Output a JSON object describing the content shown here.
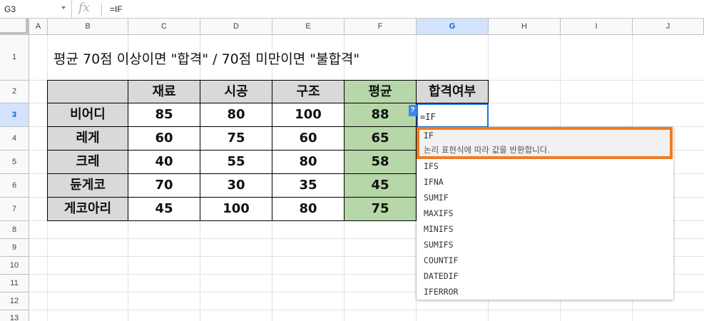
{
  "formula_bar": {
    "cell_ref": "G3",
    "fx_label": "fx",
    "formula": "=IF"
  },
  "columns": [
    "A",
    "B",
    "C",
    "D",
    "E",
    "F",
    "G",
    "H",
    "I",
    "J"
  ],
  "rows": [
    "1",
    "2",
    "3",
    "4",
    "5",
    "6",
    "7",
    "8",
    "9",
    "10",
    "11",
    "12",
    "13"
  ],
  "title": "평균 70점 이상이면 \"합격\" / 70점 미만이면 \"불합격\"",
  "table": {
    "headers": [
      "",
      "재료",
      "시공",
      "구조",
      "평균",
      "합격여부"
    ],
    "rows": [
      {
        "name": "비어디",
        "v1": "85",
        "v2": "80",
        "v3": "100",
        "avg": "88"
      },
      {
        "name": "레게",
        "v1": "60",
        "v2": "75",
        "v3": "60",
        "avg": "65"
      },
      {
        "name": "크레",
        "v1": "40",
        "v2": "55",
        "v3": "80",
        "avg": "58"
      },
      {
        "name": "듄게코",
        "v1": "70",
        "v2": "30",
        "v3": "35",
        "avg": "45"
      },
      {
        "name": "게코아리",
        "v1": "45",
        "v2": "100",
        "v3": "80",
        "avg": "75"
      }
    ]
  },
  "active_cell": {
    "text": "=IF",
    "help_badge": "?"
  },
  "autocomplete": {
    "highlighted": {
      "name": "IF",
      "description": "논리 표현식에 따라 값을 반환합니다."
    },
    "items": [
      "IFS",
      "IFNA",
      "SUMIF",
      "MAXIFS",
      "MINIFS",
      "SUMIFS",
      "COUNTIF",
      "DATEDIF",
      "IFERROR"
    ]
  },
  "colors": {
    "header_gray": "#d9d9d9",
    "avg_green": "#b6d7a8",
    "selection_blue": "#1a73e8",
    "highlight_orange": "#f07b22"
  }
}
